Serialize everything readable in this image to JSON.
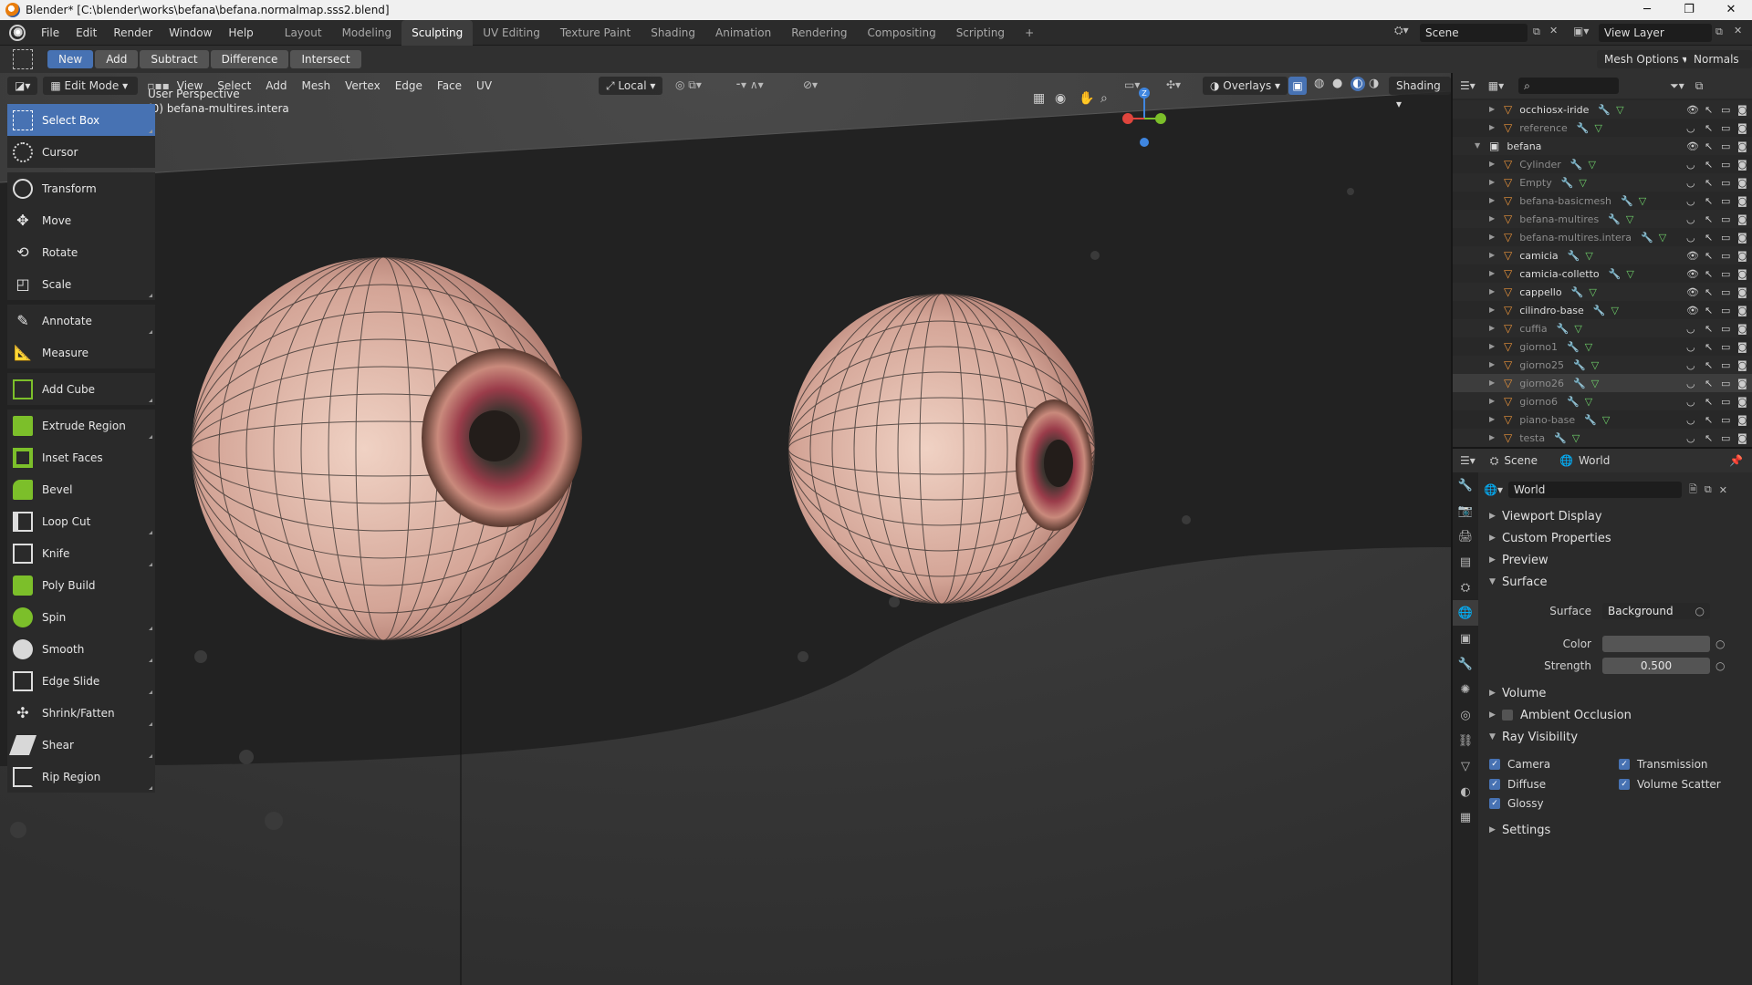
{
  "titlebar": {
    "title": "Blender* [C:\\blender\\works\\befana\\befana.normalmap.sss2.blend]"
  },
  "menu": [
    "File",
    "Edit",
    "Render",
    "Window",
    "Help"
  ],
  "workspaces": [
    "Layout",
    "Modeling",
    "Sculpting",
    "UV Editing",
    "Texture Paint",
    "Shading",
    "Animation",
    "Rendering",
    "Compositing",
    "Scripting"
  ],
  "active_workspace": "Sculpting",
  "scene_field": "Scene",
  "view_layer_field": "View Layer",
  "toolhdr": {
    "modes": [
      "New",
      "Add",
      "Subtract",
      "Difference",
      "Intersect"
    ],
    "mesh_options": "Mesh Options",
    "normals": "Normals"
  },
  "vp_header": {
    "mode": "Edit Mode",
    "menus": [
      "View",
      "Select",
      "Add",
      "Mesh",
      "Vertex",
      "Edge",
      "Face",
      "UV"
    ],
    "orientation": "Local",
    "overlays": "Overlays",
    "shading": "Shading"
  },
  "viewport": {
    "perspective": "User Perspective",
    "object": "(0) befana-multires.intera",
    "gizmo_z": "Z"
  },
  "tools": [
    {
      "label": "Select Box",
      "icon": "select-box-icon"
    },
    {
      "label": "Cursor",
      "icon": "cursor-icon"
    },
    {
      "label": "Transform",
      "icon": "transform-icon"
    },
    {
      "label": "Move",
      "icon": "move-icon"
    },
    {
      "label": "Rotate",
      "icon": "rotate-icon"
    },
    {
      "label": "Scale",
      "icon": "scale-icon"
    },
    {
      "label": "Annotate",
      "icon": "annotate-icon"
    },
    {
      "label": "Measure",
      "icon": "measure-icon"
    },
    {
      "label": "Add Cube",
      "icon": "add-cube-icon"
    },
    {
      "label": "Extrude Region",
      "icon": "extrude-icon"
    },
    {
      "label": "Inset Faces",
      "icon": "inset-icon"
    },
    {
      "label": "Bevel",
      "icon": "bevel-icon"
    },
    {
      "label": "Loop Cut",
      "icon": "loop-cut-icon"
    },
    {
      "label": "Knife",
      "icon": "knife-icon"
    },
    {
      "label": "Poly Build",
      "icon": "poly-build-icon"
    },
    {
      "label": "Spin",
      "icon": "spin-icon"
    },
    {
      "label": "Smooth",
      "icon": "smooth-icon"
    },
    {
      "label": "Edge Slide",
      "icon": "edge-slide-icon"
    },
    {
      "label": "Shrink/Fatten",
      "icon": "shrink-fatten-icon"
    },
    {
      "label": "Shear",
      "icon": "shear-icon"
    },
    {
      "label": "Rip Region",
      "icon": "rip-region-icon"
    }
  ],
  "outliner": {
    "rows": [
      {
        "name": "occhiosx-iride",
        "dim": false,
        "indent": 2
      },
      {
        "name": "reference",
        "dim": true,
        "indent": 2
      },
      {
        "name": "befana",
        "dim": false,
        "indent": 1
      },
      {
        "name": "Cylinder",
        "dim": true,
        "indent": 2
      },
      {
        "name": "Empty",
        "dim": true,
        "indent": 2
      },
      {
        "name": "befana-basicmesh",
        "dim": true,
        "indent": 2
      },
      {
        "name": "befana-multires",
        "dim": true,
        "indent": 2
      },
      {
        "name": "befana-multires.intera",
        "dim": true,
        "indent": 2
      },
      {
        "name": "camicia",
        "dim": false,
        "indent": 2
      },
      {
        "name": "camicia-colletto",
        "dim": false,
        "indent": 2
      },
      {
        "name": "cappello",
        "dim": false,
        "indent": 2
      },
      {
        "name": "cilindro-base",
        "dim": false,
        "indent": 2
      },
      {
        "name": "cuffia",
        "dim": true,
        "indent": 2
      },
      {
        "name": "giorno1",
        "dim": true,
        "indent": 2
      },
      {
        "name": "giorno25",
        "dim": true,
        "indent": 2
      },
      {
        "name": "giorno26",
        "dim": true,
        "indent": 2,
        "selected": true
      },
      {
        "name": "giorno6",
        "dim": true,
        "indent": 2
      },
      {
        "name": "piano-base",
        "dim": true,
        "indent": 2
      },
      {
        "name": "testa",
        "dim": true,
        "indent": 2
      }
    ]
  },
  "props": {
    "breadcrumb_scene": "Scene",
    "breadcrumb_world": "World",
    "datablock": "World",
    "panels": {
      "viewport_display": "Viewport Display",
      "custom_properties": "Custom Properties",
      "preview": "Preview",
      "surface": "Surface",
      "volume": "Volume",
      "ambient_occlusion": "Ambient Occlusion",
      "ray_visibility": "Ray Visibility",
      "settings": "Settings"
    },
    "surface_label": "Surface",
    "surface_value": "Background",
    "color_label": "Color",
    "strength_label": "Strength",
    "strength_value": "0.500",
    "ray": {
      "camera": "Camera",
      "transmission": "Transmission",
      "diffuse": "Diffuse",
      "volume_scatter": "Volume Scatter",
      "glossy": "Glossy"
    }
  },
  "colors": {
    "accent": "#4772b3",
    "object_icon": "#e8923a",
    "gizmo_x": "#e0453d",
    "gizmo_y": "#7cbf2a",
    "gizmo_z": "#3f86e0"
  }
}
